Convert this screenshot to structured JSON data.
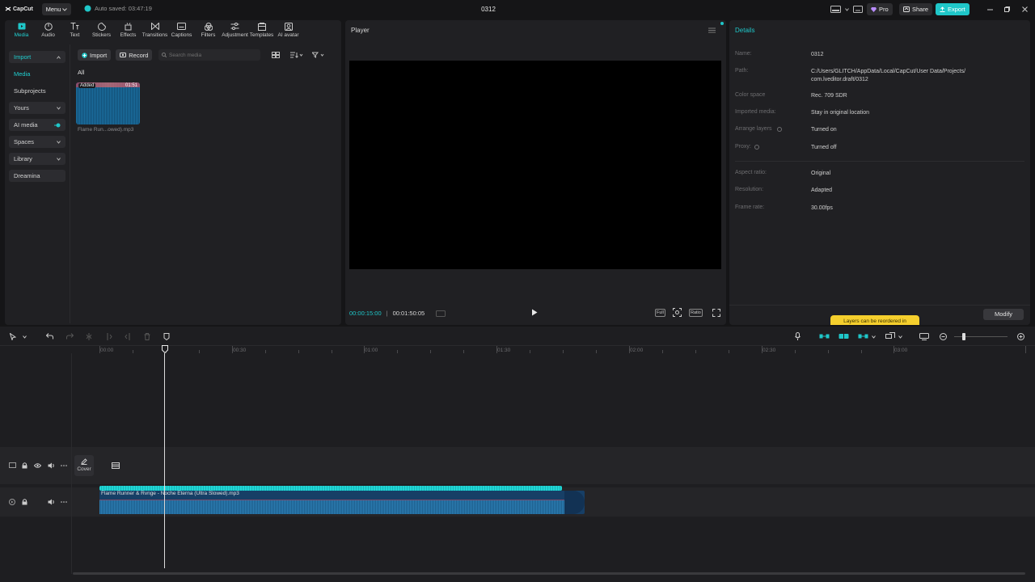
{
  "titlebar": {
    "logo": "CapCut",
    "menu_label": "Menu",
    "autosave_text": "Auto saved: 03:47:19",
    "project_title": "0312",
    "pro_label": "Pro",
    "share_label": "Share",
    "export_label": "Export",
    "accent": "#1fc7c9"
  },
  "toolbar": {
    "tabs": [
      "Media",
      "Audio",
      "Text",
      "Stickers",
      "Effects",
      "Transitions",
      "Captions",
      "Filters",
      "Adjustment",
      "Templates",
      "AI avatar"
    ],
    "active": "Media"
  },
  "sidebar": {
    "items": [
      {
        "label": "Import"
      },
      {
        "label": "Media"
      },
      {
        "label": "Subprojects"
      },
      {
        "label": "Yours"
      },
      {
        "label": "AI media"
      },
      {
        "label": "Spaces"
      },
      {
        "label": "Library"
      },
      {
        "label": "Dreamina"
      }
    ]
  },
  "media": {
    "import_label": "Import",
    "record_label": "Record",
    "search_placeholder": "Search media",
    "filter_label": "All",
    "item": {
      "badge": "Added",
      "duration": "01:51",
      "name": "Flame Run...owed).mp3"
    }
  },
  "player": {
    "title": "Player",
    "current_time": "00:00:15:00",
    "total_time": "00:01:50:05",
    "full_label": "Full",
    "ratio_label": "Ratio"
  },
  "details": {
    "title": "Details",
    "rows": [
      {
        "label": "Name:",
        "value": "0312"
      },
      {
        "label": "Path:",
        "value": "C:/Users/GLITCH/AppData/Local/CapCut/User Data/Projects/",
        "value2": "com.lveditor.draft/0312"
      },
      {
        "label": "Color space",
        "value": "Rec. 709 SDR"
      },
      {
        "label": "Imported media:",
        "value": "Stay in original location"
      },
      {
        "label": "Arrange layers",
        "value": "Turned on"
      },
      {
        "label": "Proxy:",
        "value": "Turned off"
      },
      {
        "label": "Aspect ratio:",
        "value": "Original"
      },
      {
        "label": "Resolution:",
        "value": "Adapted"
      },
      {
        "label": "Frame rate:",
        "value": "30.00fps"
      }
    ],
    "tooltip": "Layers can be reordered in",
    "modify_label": "Modify"
  },
  "timeline": {
    "ruler": [
      "00:00",
      "00:30",
      "01:00",
      "01:30",
      "02:00",
      "02:30",
      "03:00"
    ],
    "cover_label": "Cover",
    "audio_clip_name": "Flame Runner & Rvnge - Noche Eterna (Ultra Slowed).mp3"
  }
}
